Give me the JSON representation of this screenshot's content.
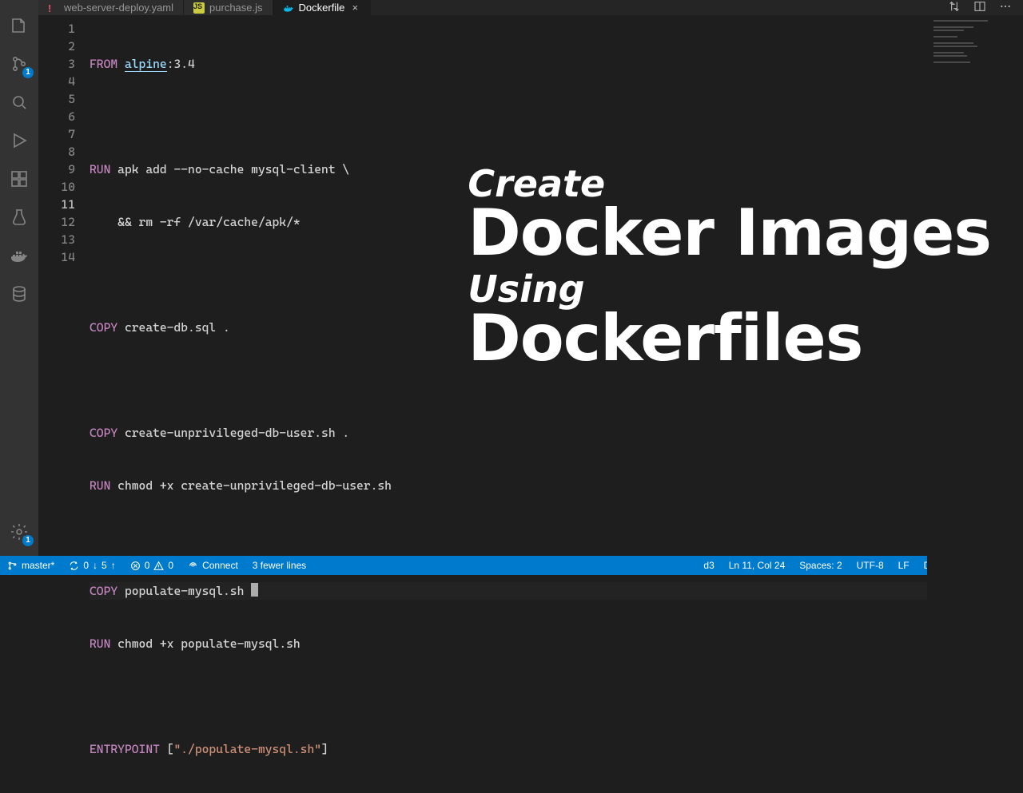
{
  "tabs": [
    {
      "label": "web-server-deploy.yaml",
      "icon": "!"
    },
    {
      "label": "purchase.js",
      "icon": "JS"
    },
    {
      "label": "Dockerfile",
      "icon": "docker",
      "active": true
    }
  ],
  "activity": {
    "scm_badge": "1",
    "settings_badge": "1"
  },
  "editor": {
    "line_count": 14,
    "current_line": 11,
    "lines": {
      "l1_kw": "FROM",
      "l1_id": "alpine",
      "l1_rest": ":3.4",
      "l3_kw": "RUN",
      "l3_rest": " apk add --no-cache mysql-client \\",
      "l4_rest": "    && rm -rf /var/cache/apk/*",
      "l6_kw": "COPY",
      "l6_rest": " create-db.sql .",
      "l8_kw": "COPY",
      "l8_rest": " create-unprivileged-db-user.sh .",
      "l9_kw": "RUN",
      "l9_rest": " chmod +x create-unprivileged-db-user.sh",
      "l11_kw": "COPY",
      "l11_rest": " populate-mysql.sh ",
      "l12_kw": "RUN",
      "l12_rest": " chmod +x populate-mysql.sh",
      "l14_kw": "ENTRYPOINT",
      "l14_rest": " [",
      "l14_str": "\"./populate-mysql.sh\"",
      "l14_end": "]"
    }
  },
  "overlay": {
    "l1": "Create",
    "l2": "Docker Images",
    "l3": "Using",
    "l4": "Dockerfiles"
  },
  "status": {
    "branch": "master*",
    "sync_down": "0",
    "sync_up": "5",
    "errors": "0",
    "warnings": "0",
    "connect": "Connect",
    "diff": "3 fewer lines",
    "right_misc": "d3",
    "cursor": "Ln 11, Col 24",
    "spaces": "Spaces: 2",
    "encoding": "UTF-8",
    "eol": "LF",
    "language": "Dockerfile"
  }
}
